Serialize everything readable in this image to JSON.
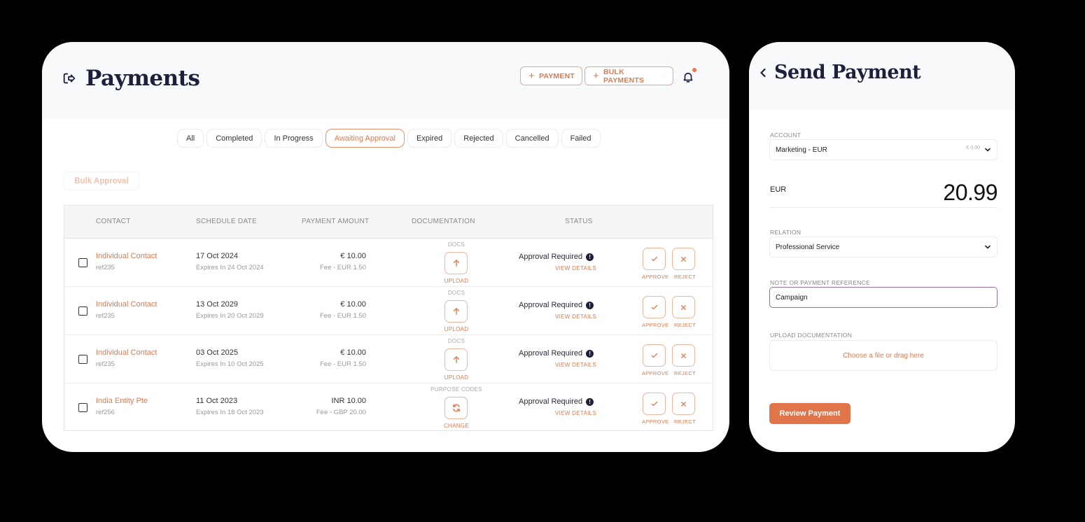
{
  "payments": {
    "title": "Payments",
    "header_buttons": {
      "payment_label": "PAYMENT",
      "bulk_payments_label": "BULK PAYMENTS"
    },
    "tabs": [
      {
        "label": "All",
        "active": false
      },
      {
        "label": "Completed",
        "active": false
      },
      {
        "label": "In Progress",
        "active": false
      },
      {
        "label": "Awaiting Approval",
        "active": true
      },
      {
        "label": "Expired",
        "active": false
      },
      {
        "label": "Rejected",
        "active": false
      },
      {
        "label": "Cancelled",
        "active": false
      },
      {
        "label": "Failed",
        "active": false
      }
    ],
    "bulk_approval_label": "Bulk Approval",
    "table": {
      "columns": [
        "CONTACT",
        "SCHEDULE DATE",
        "PAYMENT AMOUNT",
        "DOCUMENTATION",
        "STATUS"
      ],
      "rows": [
        {
          "contact": "Individual Contact",
          "ref": "ref235",
          "date": "17 Oct 2024",
          "expires": "Expires In 24 Oct 2024",
          "amount": "€ 10.00",
          "fee": "Fee - EUR 1.50",
          "doc_label": "DOCS",
          "doc_action": "UPLOAD",
          "doc_icon": "upload-arrow-icon",
          "status": "Approval Required",
          "view_details": "VIEW DETAILS",
          "approve": "APPROVE",
          "reject": "REJECT"
        },
        {
          "contact": "Individual Contact",
          "ref": "ref235",
          "date": "13 Oct 2029",
          "expires": "Expires In 20 Oct 2029",
          "amount": "€ 10.00",
          "fee": "Fee - EUR 1.50",
          "doc_label": "DOCS",
          "doc_action": "UPLOAD",
          "doc_icon": "upload-arrow-icon",
          "status": "Approval Required",
          "view_details": "VIEW DETAILS",
          "approve": "APPROVE",
          "reject": "REJECT"
        },
        {
          "contact": "Individual Contact",
          "ref": "ref235",
          "date": "03 Oct 2025",
          "expires": "Expires In 10 Oct 2025",
          "amount": "€ 10.00",
          "fee": "Fee - EUR 1.50",
          "doc_label": "DOCS",
          "doc_action": "UPLOAD",
          "doc_icon": "upload-arrow-icon",
          "status": "Approval Required",
          "view_details": "VIEW DETAILS",
          "approve": "APPROVE",
          "reject": "REJECT"
        },
        {
          "contact": "India Entity Pte",
          "ref": "ref256",
          "date": "11 Oct 2023",
          "expires": "Expires In 18 Oct 2023",
          "amount": "INR 10.00",
          "fee": "Fee - GBP 20.00",
          "doc_label": "PURPOSE CODES",
          "doc_action": "CHANGE",
          "doc_icon": "refresh-icon",
          "status": "Approval Required",
          "view_details": "VIEW DETAILS",
          "approve": "APPROVE",
          "reject": "REJECT"
        }
      ]
    }
  },
  "send_payment": {
    "title": "Send Payment",
    "account": {
      "label": "ACCOUNT",
      "value": "Marketing - EUR",
      "balance": "€ 0.00"
    },
    "amount": {
      "currency": "EUR",
      "value": "20.99"
    },
    "relation": {
      "label": "RELATION",
      "value": "Professional Service"
    },
    "note": {
      "label": "NOTE OR PAYMENT REFERENCE",
      "value": "Campaign"
    },
    "upload": {
      "label": "UPLOAD DOCUMENTATION",
      "placeholder": "Choose a file or drag here"
    },
    "review_button": "Review Payment"
  },
  "colors": {
    "accent": "#e0754a",
    "title": "#1d1f3b",
    "note_focus": "#9b6d9d"
  }
}
